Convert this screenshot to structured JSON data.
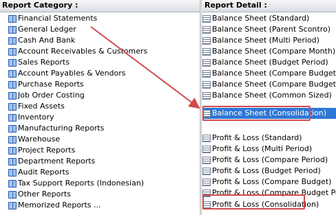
{
  "left": {
    "header": "Report Category :",
    "items": [
      "Financial Statements",
      "General Ledger",
      "Cash And Bank",
      "Account Receivables & Customers",
      "Sales Reports",
      "Account Payables & Vendors",
      "Purchase Reports",
      "Job Order Costing",
      "Fixed Assets",
      "Inventory",
      "Manufacturing Reports",
      "Warehouse",
      "Project Reports",
      "Department Reports",
      "Audit Reports",
      "Tax Support Reports (Indonesian)",
      "Other Reports",
      "Memorized Reports ..."
    ]
  },
  "right": {
    "header": "Report Detail :",
    "items": [
      "Balance Sheet (Standard)",
      "Balance Sheet (Parent Scontro)",
      "Balance Sheet (Multi Period)",
      "Balance Sheet (Compare Month)",
      "Balance Sheet (Budget Period)",
      "Balance Sheet (Compare Budget)",
      "Balance Sheet (Compare Budget Period)",
      "Balance Sheet (Common Sized)",
      "Balance Sheet (Consolidation)",
      "",
      "Profit & Loss (Standard)",
      "Profit & Loss (Multi Period)",
      "Profit & Loss (Compare Period)",
      "Profit & Loss (Budget Period)",
      "Profit & Loss (Compare Budget)",
      "Profit & Loss (Compare Budget Period)",
      "Profit & Loss (Consolidation)"
    ],
    "selected_index": 8
  },
  "colors": {
    "selection": "#2f77d6",
    "annotation": "#d24a4a"
  }
}
